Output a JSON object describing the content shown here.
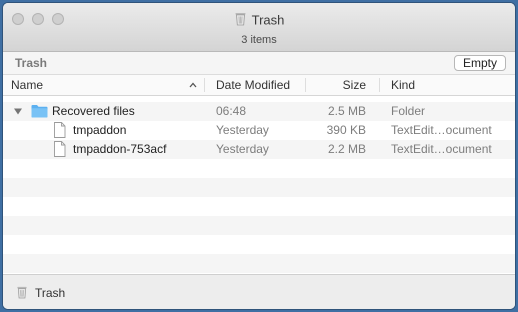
{
  "window": {
    "title": "Trash",
    "item_count": "3 items"
  },
  "pathbar": {
    "location": "Trash",
    "empty_button": "Empty"
  },
  "columns": {
    "name": "Name",
    "date_modified": "Date Modified",
    "size": "Size",
    "kind": "Kind",
    "sort_indicator": "chevron-up-icon"
  },
  "files": [
    {
      "name": "Recovered files",
      "date": "06:48",
      "size": "2.5 MB",
      "kind": "Folder",
      "type": "folder",
      "expanded": true
    },
    {
      "name": "tmpaddon",
      "date": "Yesterday",
      "size": "390 KB",
      "kind": "TextEdit…ocument",
      "type": "document"
    },
    {
      "name": "tmpaddon-753acf",
      "date": "Yesterday",
      "size": "2.2 MB",
      "kind": "TextEdit…ocument",
      "type": "document"
    }
  ],
  "statusbar": {
    "label": "Trash",
    "icon": "trash-icon"
  },
  "colors": {
    "folder": "#5cb0f0",
    "desktop": "#3f6fa3",
    "titlebar": "#dcdcdc"
  }
}
